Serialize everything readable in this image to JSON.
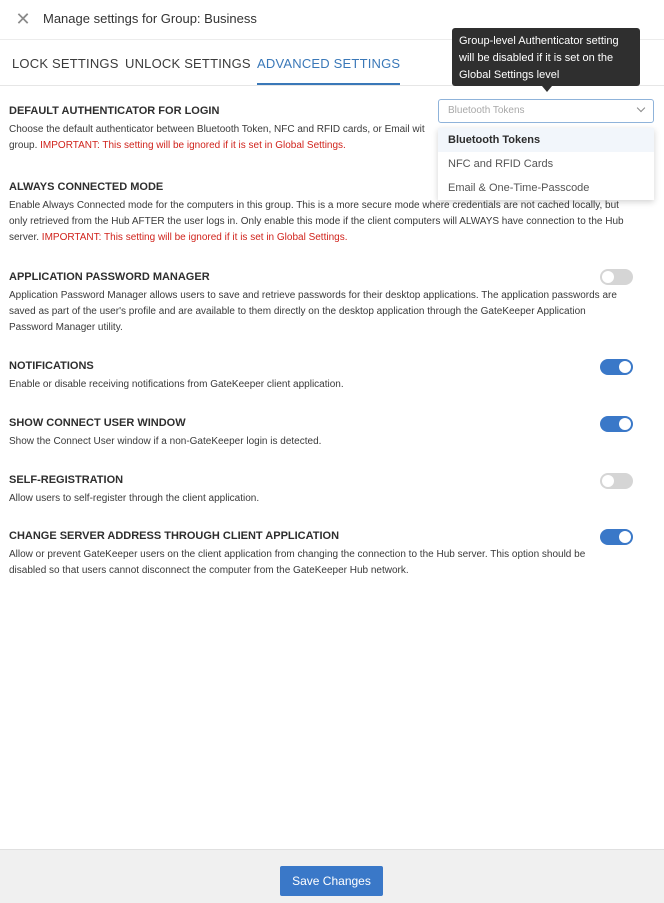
{
  "header": {
    "close_icon": "close-icon",
    "title": "Manage settings for Group: Business"
  },
  "tabs": [
    {
      "label": "LOCK SETTINGS",
      "active": false
    },
    {
      "label": "UNLOCK SETTINGS",
      "active": false
    },
    {
      "label": "ADVANCED SETTINGS",
      "active": true
    }
  ],
  "tooltip": {
    "line1": "Group-level Authenticator setting",
    "line2": "will be disabled if it is set on the",
    "line3": "Global Settings level"
  },
  "default_authenticator": {
    "title": "DEFAULT AUTHENTICATOR FOR LOGIN",
    "desc_line1": "Choose the default authenticator between Bluetooth Token, NFC and RFID cards, or Email wit",
    "desc_line2_prefix": "group. ",
    "desc_line2_warning": "IMPORTANT: This setting will be ignored if it is set in Global Settings.",
    "select_value": "Bluetooth Tokens",
    "options": [
      "Bluetooth Tokens",
      "NFC and RFID Cards",
      "Email & One-Time-Passcode"
    ],
    "selected_option": "Bluetooth Tokens"
  },
  "always_connected": {
    "title": "ALWAYS CONNECTED MODE",
    "desc_line1": "Enable Always Connected mode for the computers in this group. This is a more secure mode where credentials are not cached locally, but",
    "desc_line2": "only retrieved from the Hub AFTER the user logs in. Only enable this mode if the client computers will ALWAYS have connection to the Hub",
    "desc_line3_prefix": "server. ",
    "desc_line3_warning": "IMPORTANT: This setting will be ignored if it is set in Global Settings."
  },
  "password_manager": {
    "title": "APPLICATION PASSWORD MANAGER",
    "desc_line1": "Application Password Manager allows users to save and retrieve passwords for their desktop applications. The application passwords are",
    "desc_line2": "saved as part of the user's profile and are available to them directly on the desktop application through the GateKeeper Application",
    "desc_line3": "Password Manager utility.",
    "enabled": false
  },
  "notifications": {
    "title": "NOTIFICATIONS",
    "desc": "Enable or disable receiving notifications from GateKeeper client application.",
    "enabled": true
  },
  "connect_user_window": {
    "title": "SHOW CONNECT USER WINDOW",
    "desc": "Show the Connect User window if a non-GateKeeper login is detected.",
    "enabled": true
  },
  "self_registration": {
    "title": "SELF-REGISTRATION",
    "desc": "Allow users to self-register through the client application.",
    "enabled": false
  },
  "change_server": {
    "title": "CHANGE SERVER ADDRESS THROUGH CLIENT APPLICATION",
    "desc_line1": "Allow or prevent GateKeeper users on the client application from changing the connection to the Hub server. This option should be",
    "desc_line2": "disabled so that users cannot disconnect the computer from the GateKeeper Hub network.",
    "enabled": true
  },
  "footer": {
    "save_label": "Save Changes"
  },
  "colors": {
    "accent": "#3a78c8",
    "warning": "#d0231c",
    "tooltip_bg": "#2f2f2f",
    "toggle_off": "#d5d5d5"
  }
}
